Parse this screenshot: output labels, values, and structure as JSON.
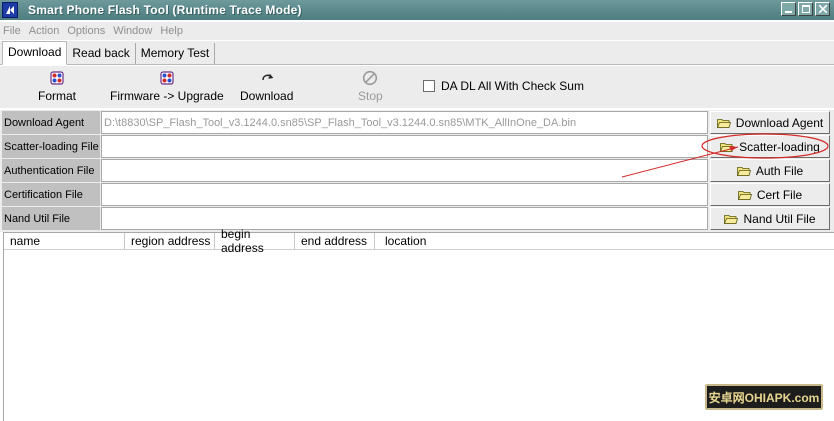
{
  "window": {
    "title": "Smart Phone Flash Tool (Runtime Trace Mode)",
    "app_icon": "flash-tool-logo-icon",
    "controls": [
      "minimize-icon",
      "maximize-icon",
      "close-icon"
    ]
  },
  "menu": [
    "File",
    "Action",
    "Options",
    "Window",
    "Help"
  ],
  "tabs": [
    {
      "label": "Download",
      "active": true
    },
    {
      "label": "Read back",
      "active": false
    },
    {
      "label": "Memory Test",
      "active": false
    }
  ],
  "toolbar": {
    "format": {
      "label": "Format",
      "icon": "format-icon"
    },
    "firmware": {
      "label": "Firmware -> Upgrade",
      "icon": "firmware-upgrade-icon"
    },
    "download": {
      "label": "Download",
      "icon": "download-arrow-icon"
    },
    "stop": {
      "label": "Stop",
      "icon": "stop-icon",
      "disabled": true
    },
    "checksum": {
      "label": "DA DL All With Check Sum",
      "checked": false
    }
  },
  "fields": [
    {
      "label": "Download Agent",
      "value": "D:\\t8830\\SP_Flash_Tool_v3.1244.0.sn85\\SP_Flash_Tool_v3.1244.0.sn85\\MTK_AllInOne_DA.bin",
      "button": "Download Agent"
    },
    {
      "label": "Scatter-loading File",
      "value": "",
      "button": "Scatter-loading"
    },
    {
      "label": "Authentication File",
      "value": "",
      "button": "Auth File"
    },
    {
      "label": "Certification File",
      "value": "",
      "button": "Cert File"
    },
    {
      "label": "Nand Util File",
      "value": "",
      "button": "Nand Util File"
    }
  ],
  "table": {
    "columns": [
      "name",
      "region address",
      "begin address",
      "end address",
      "location"
    ],
    "rows": []
  },
  "watermark": "安卓网OHIAPK.com",
  "colors": {
    "title_bar": "#5c8a8d",
    "label_bg": "#c0c0c0",
    "annotation": "#d42a2a"
  }
}
